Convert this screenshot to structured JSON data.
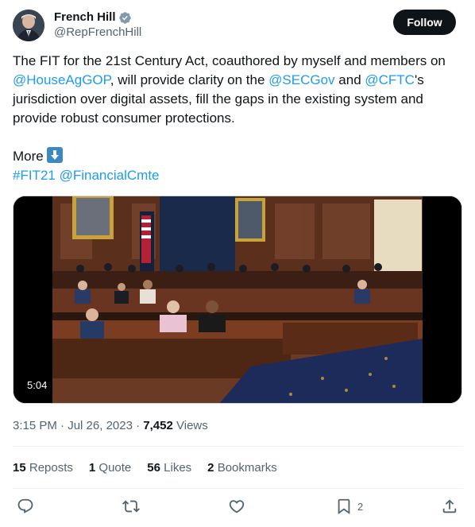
{
  "author": {
    "display_name": "French Hill",
    "handle": "@RepFrenchHill",
    "verified": true,
    "avatar_icon": "avatar-photo"
  },
  "follow_label": "Follow",
  "tweet": {
    "t1": "The FIT for the 21st Century Act, coauthored by myself and members on ",
    "m1": "@HouseAgGOP",
    "t2": ", will provide clarity on the ",
    "m2": "@SECGov",
    "t3": " and ",
    "m3": "@CFTC",
    "t4": "'s jurisdiction over digital assets, fill the gaps in the existing system and provide robust consumer protections.",
    "more": "More ",
    "more_emoji": "down-arrow-emoji-icon",
    "hashtag": "#FIT21",
    "m4": "@FinancialCmte"
  },
  "media": {
    "duration": "5:04"
  },
  "meta": {
    "time": "3:15 PM",
    "date": "Jul 26, 2023",
    "views": "7,452",
    "views_label": "Views",
    "sep": " · "
  },
  "stats": {
    "reposts": "15",
    "reposts_label": "Reposts",
    "quotes": "1",
    "quotes_label": "Quote",
    "likes": "56",
    "likes_label": "Likes",
    "bookmarks": "2",
    "bookmarks_label": "Bookmarks"
  },
  "actions": {
    "bookmark_count": "2",
    "icons": [
      "reply-icon",
      "repost-icon",
      "like-icon",
      "bookmark-icon",
      "share-icon"
    ]
  },
  "colors": {
    "link": "#1d9bf0",
    "text": "#0f1419",
    "secondary": "#536471",
    "verified": "#829aab"
  }
}
